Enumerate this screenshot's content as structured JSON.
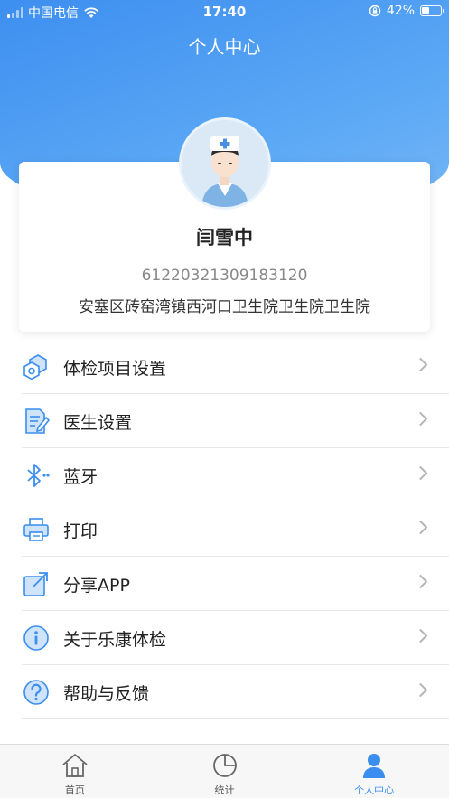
{
  "status_bar": {
    "carrier": "中国电信",
    "time": "17:40",
    "battery": "42%",
    "battery_level": 0.42
  },
  "header": {
    "title": "个人中心"
  },
  "profile": {
    "name": "闫雪中",
    "id_number": "61220321309183120",
    "organization": "安塞区砖窑湾镇西河口卫生院卫生院卫生院"
  },
  "menu": {
    "items": [
      {
        "label": "体检项目设置",
        "icon": "hexagon-settings-icon"
      },
      {
        "label": "医生设置",
        "icon": "document-edit-icon"
      },
      {
        "label": "蓝牙",
        "icon": "bluetooth-icon"
      },
      {
        "label": "打印",
        "icon": "printer-icon"
      },
      {
        "label": "分享APP",
        "icon": "share-icon"
      },
      {
        "label": "关于乐康体检",
        "icon": "info-icon"
      },
      {
        "label": "帮助与反馈",
        "icon": "help-icon"
      }
    ]
  },
  "tabs": [
    {
      "label": "首页",
      "icon": "home-icon"
    },
    {
      "label": "统计",
      "icon": "pie-chart-icon"
    },
    {
      "label": "个人中心",
      "icon": "person-icon",
      "active": true
    }
  ],
  "colors": {
    "accent": "#3a8ef0",
    "header_gradient_start": "#3d8ff0",
    "header_gradient_end": "#74b6f7",
    "icon_stroke": "#3a8ef0",
    "icon_fill": "#cfe4fb"
  }
}
